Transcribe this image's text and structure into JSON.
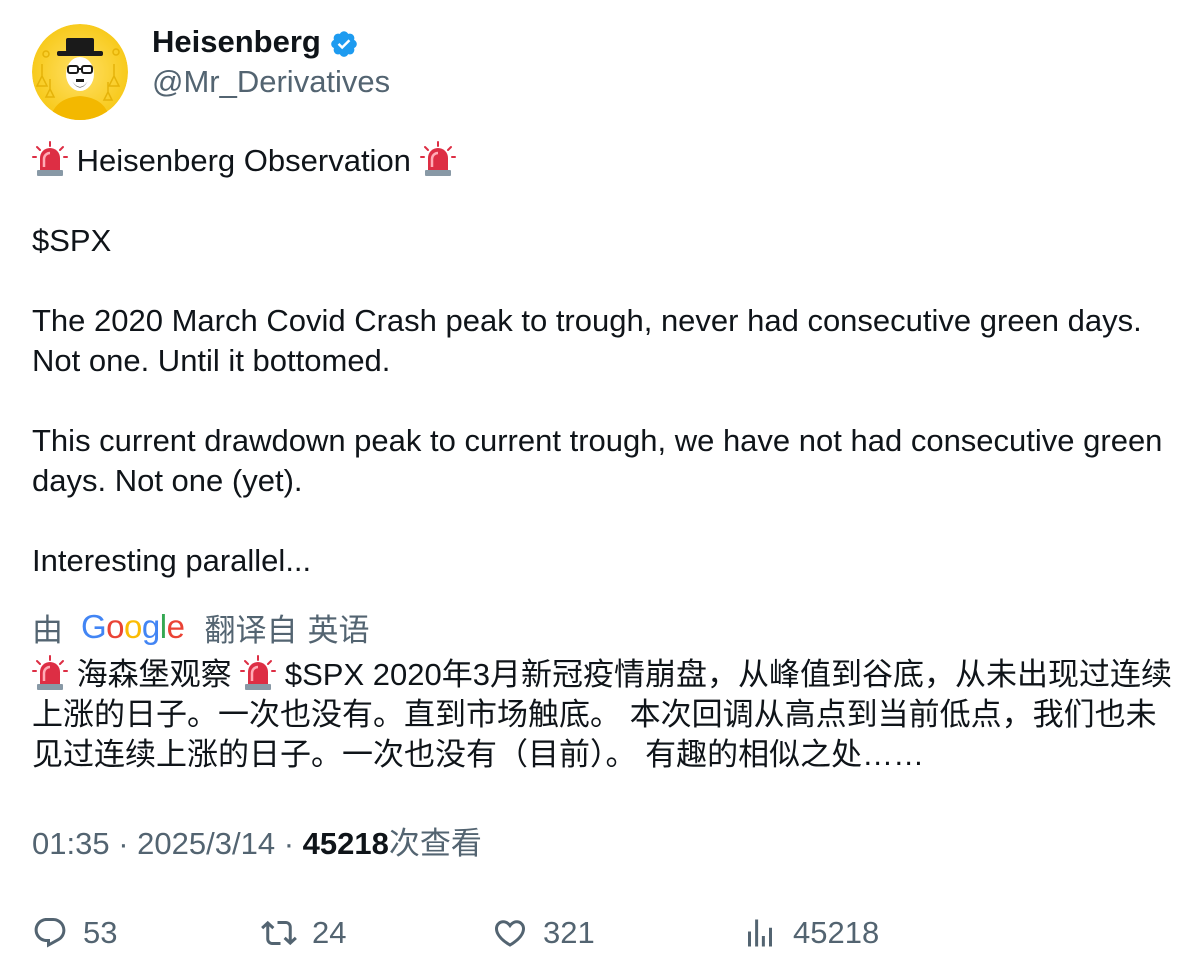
{
  "user": {
    "display_name": "Heisenberg",
    "handle": "@Mr_Derivatives",
    "verified": true,
    "verified_color": "#1d9bf0"
  },
  "tweet": {
    "title_text": "Heisenberg Observation",
    "title_icon": "police-car-light-icon",
    "ticker": "$SPX",
    "paragraph_1": "The 2020 March Covid Crash peak to trough, never had consecutive green days. Not one. Until it bottomed.",
    "paragraph_2": "This current drawdown peak to current trough, we have not had consecutive green days. Not one (yet).",
    "paragraph_3": "Interesting parallel..."
  },
  "translation": {
    "by_label": "由",
    "provider": "Google",
    "translated_from": "翻译自",
    "language": "英语",
    "title_text": "海森堡观察",
    "text": "$SPX 2020年3月新冠疫情崩盘，从峰值到谷底，从未出现过连续上涨的日子。一次也没有。直到市场触底。 本次回调从高点到当前低点，我们也未见过连续上涨的日子。一次也没有（目前）。 有趣的相似之处……"
  },
  "meta": {
    "time": "01:35",
    "separator": "·",
    "date": "2025/3/14",
    "views_count": "45218",
    "views_label": "次查看"
  },
  "actions": {
    "replies": "53",
    "retweets": "24",
    "likes": "321",
    "views": "45218"
  },
  "colors": {
    "text_primary": "#0f1419",
    "text_secondary": "#536471",
    "accent": "#1d9bf0"
  }
}
